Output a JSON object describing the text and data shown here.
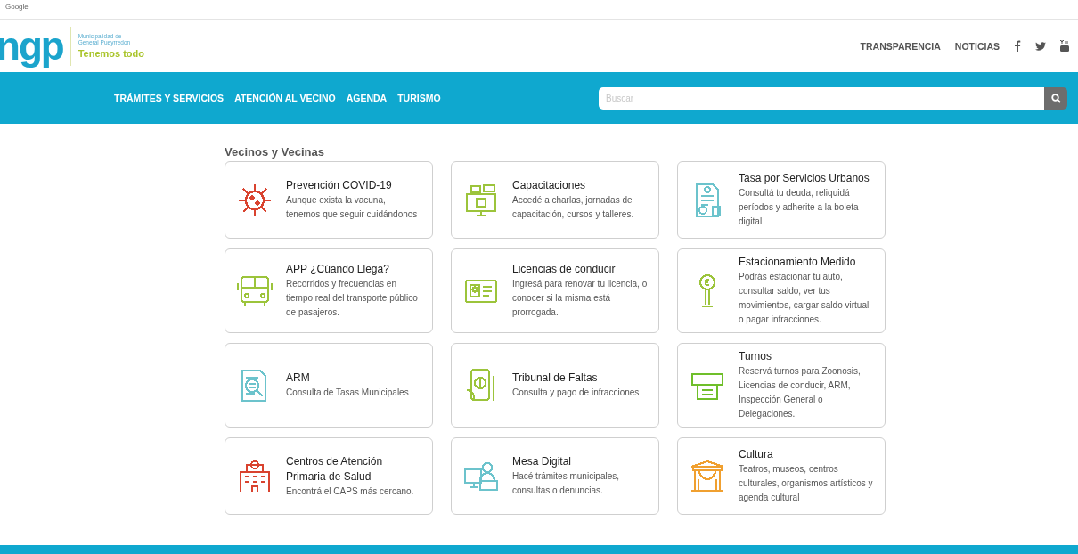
{
  "browser_bar": {
    "label": "Google"
  },
  "logo": {
    "mark": "ngp",
    "line_1": "Municipalidad de",
    "line_2": "General Pueyrredon",
    "slogan": "Tenemos todo"
  },
  "top_links": [
    "TRANSPARENCIA",
    "NOTICIAS"
  ],
  "nav": [
    "TRÁMITES Y SERVICIOS",
    "ATENCIÓN AL VECINO",
    "AGENDA",
    "TURISMO"
  ],
  "search": {
    "placeholder": "Buscar"
  },
  "section_title": "Vecinos y Vecinas",
  "cards": [
    {
      "title": "Prevención COVID-19",
      "text": "Aunque exista la vacuna, tenemos que seguir cuidándonos",
      "color": "#d9432f"
    },
    {
      "title": "Capacitaciones",
      "text": "Accedé a charlas, jornadas de capacitación, cursos y talleres.",
      "color": "#9cc43b"
    },
    {
      "title": "Tasa por Servicios Urbanos",
      "text": "Consultá tu deuda, reliquidá períodos y adherite a la boleta digital",
      "color": "#6cc3cc"
    },
    {
      "title": "APP ¿Cúando Llega?",
      "text": "Recorridos y frecuencias en tiempo real del transporte público de pasajeros.",
      "color": "#9cc43b"
    },
    {
      "title": "Licencias de conducir",
      "text": "Ingresá para renovar tu licencia, o conocer si la misma está prorrogada.",
      "color": "#9cc43b"
    },
    {
      "title": "Estacionamiento Medido",
      "text": "Podrás estacionar tu auto, consultar saldo, ver tus movimientos, cargar saldo virtual o pagar infracciones.",
      "color": "#9cc43b"
    },
    {
      "title": "ARM",
      "text": "Consulta de Tasas Municipales",
      "color": "#6cc3cc"
    },
    {
      "title": "Tribunal de Faltas",
      "text": "Consulta y pago de infracciones",
      "color": "#9cc43b"
    },
    {
      "title": "Turnos",
      "text": "Reservá turnos para Zoonosis, Licencias de conducir, ARM, Inspección General o Delegaciones.",
      "color": "#6fbf2a"
    },
    {
      "title": "Centros de Atención Primaria de Salud",
      "text": "Encontrá el CAPS más cercano.",
      "color": "#d9432f"
    },
    {
      "title": "Mesa Digital",
      "text": "Hacé trámites municipales, consultas o denuncias.",
      "color": "#6cc3cc"
    },
    {
      "title": "Cultura",
      "text": "Teatros, museos, centros culturales, organismos artísticos y agenda cultural",
      "color": "#f0a030"
    }
  ]
}
